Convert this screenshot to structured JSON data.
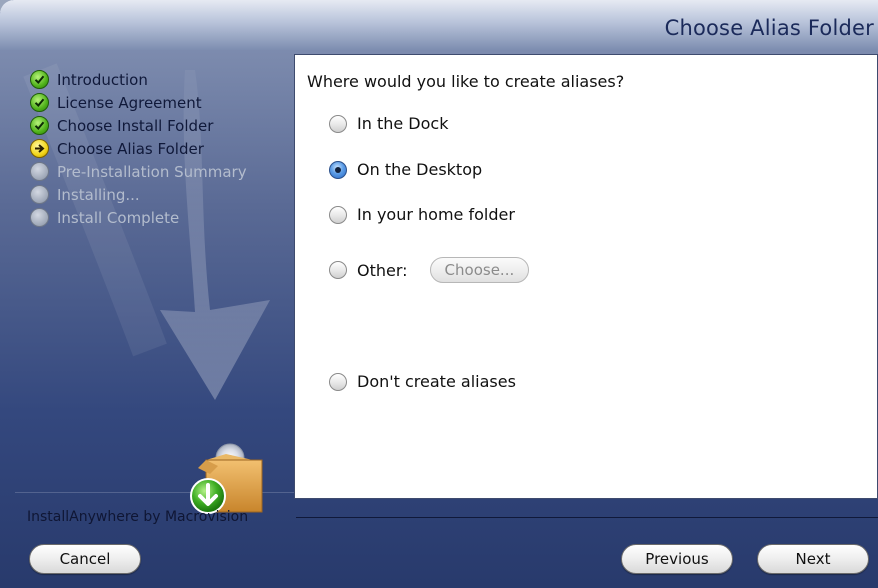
{
  "header": {
    "title": "Choose Alias Folder"
  },
  "steps": [
    {
      "label": "Introduction",
      "state": "done"
    },
    {
      "label": "License Agreement",
      "state": "done"
    },
    {
      "label": "Choose Install Folder",
      "state": "done"
    },
    {
      "label": "Choose Alias Folder",
      "state": "current"
    },
    {
      "label": "Pre-Installation Summary",
      "state": "pending"
    },
    {
      "label": "Installing...",
      "state": "pending"
    },
    {
      "label": "Install Complete",
      "state": "pending"
    }
  ],
  "panel": {
    "question": "Where would you like to create aliases?",
    "options": [
      {
        "label": "In the Dock",
        "selected": false
      },
      {
        "label": "On the Desktop",
        "selected": true
      },
      {
        "label": "In your home folder",
        "selected": false
      },
      {
        "label": "Other:",
        "selected": false
      },
      {
        "label": "Don't create aliases",
        "selected": false
      }
    ],
    "choose_button": "Choose..."
  },
  "footer": {
    "brand": "InstallAnywhere by Macrovision",
    "cancel": "Cancel",
    "previous": "Previous",
    "next": "Next"
  },
  "colors": {
    "done": "#4fb21a",
    "current": "#f2d518",
    "pending": "#9ea7b7",
    "selected_radio": "#2566c5"
  },
  "icons": {
    "done": "checkmark-circle-icon",
    "current": "arrow-right-circle-icon",
    "pending": "grey-circle-icon",
    "installer": "package-box-download-icon"
  }
}
